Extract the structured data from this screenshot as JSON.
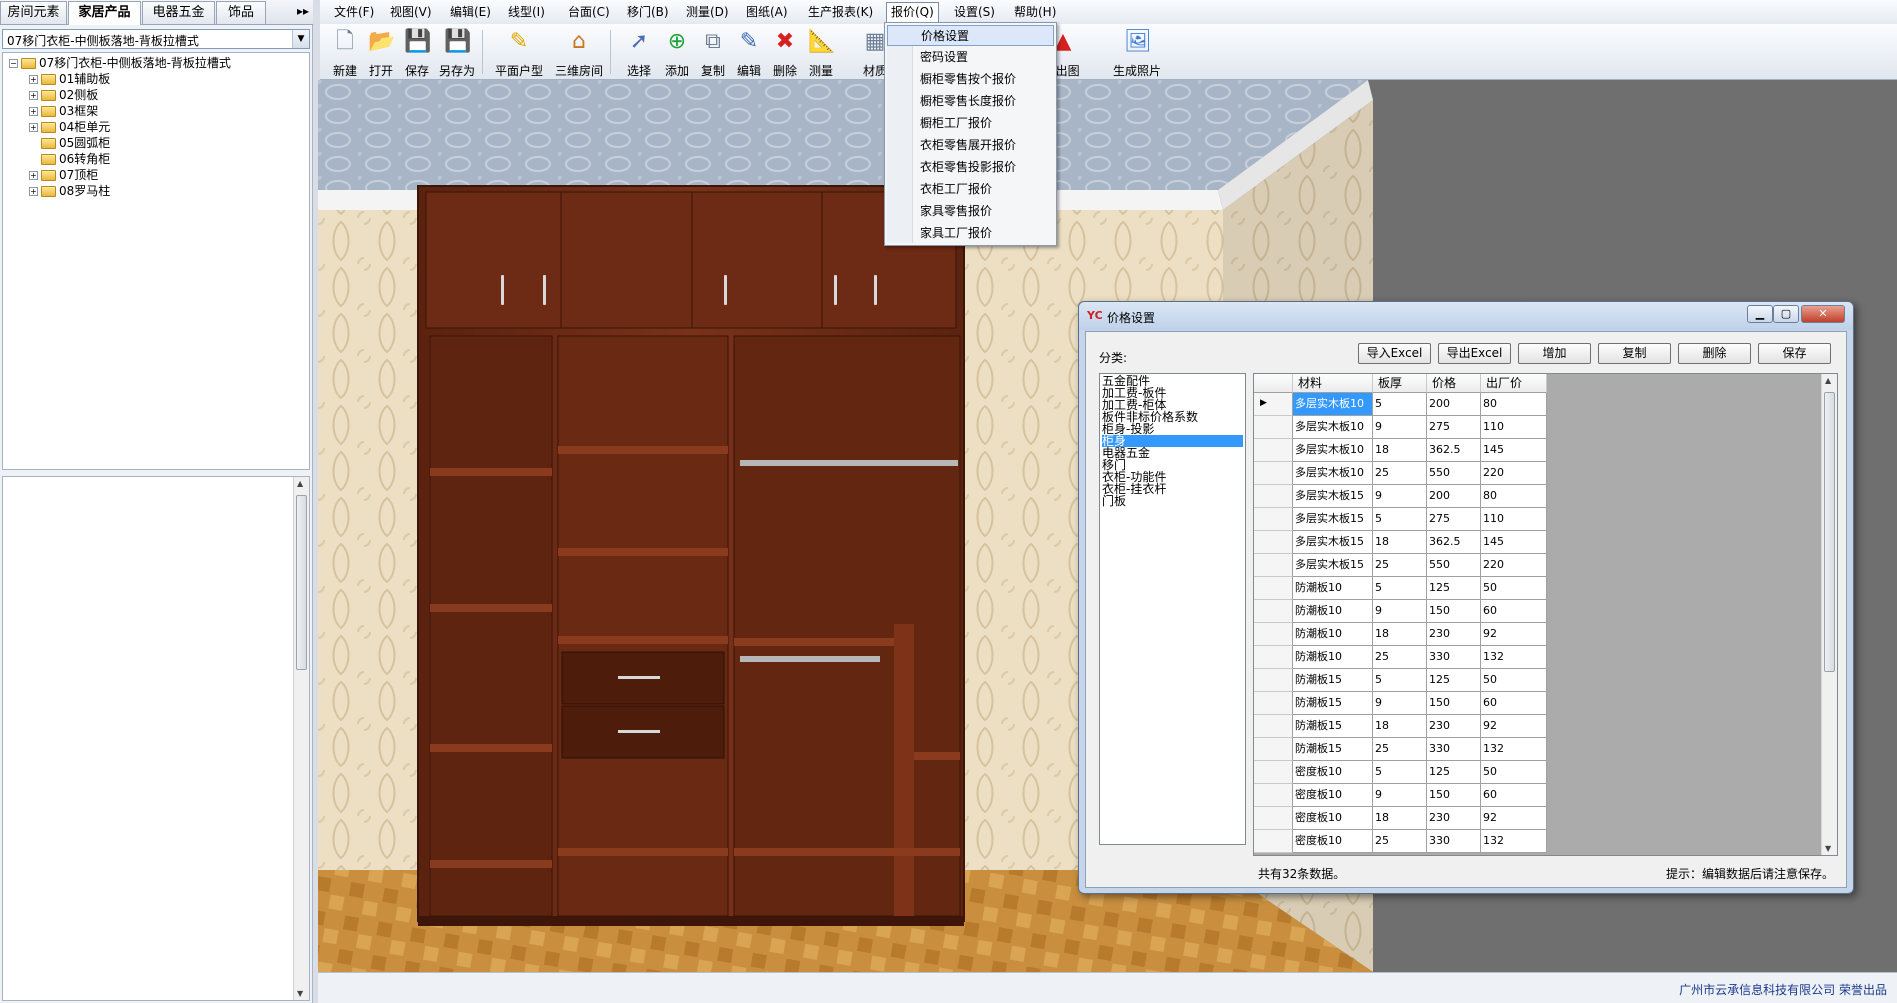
{
  "left": {
    "tabs": [
      "房间元素",
      "家居产品",
      "电器五金",
      "饰品"
    ],
    "tab_more": "▸▸",
    "selector_value": "07移门衣柜-中侧板落地-背板拉槽式",
    "tree_root": "07移门衣柜-中侧板落地-背板拉槽式",
    "tree_items": [
      "01辅助板",
      "02侧板",
      "03框架",
      "04柜单元",
      "05圆弧柜",
      "06转角柜",
      "07顶柜",
      "08罗马柱"
    ]
  },
  "menu": [
    "文件(F)",
    "视图(V)",
    "编辑(E)",
    "线型(I)",
    "台面(C)",
    "移门(B)",
    "测量(D)",
    "图纸(A)",
    "生产报表(K)",
    "报价(Q)",
    "设置(S)",
    "帮助(H)"
  ],
  "toolbar": [
    "新建",
    "打开",
    "保存",
    "另存为",
    "平面户型",
    "三维房间",
    "选择",
    "添加",
    "复制",
    "编辑",
    "删除",
    "测量",
    "材质",
    "D出图",
    "生成照片"
  ],
  "quote_menu": [
    "价格设置",
    "密码设置",
    "橱柜零售按个报价",
    "橱柜零售长度报价",
    "橱柜工厂报价",
    "衣柜零售展开报价",
    "衣柜零售投影报价",
    "衣柜工厂报价",
    "家具零售报价",
    "家具工厂报价"
  ],
  "dialog": {
    "title": "价格设置",
    "logo": "YC",
    "category_label": "分类:",
    "buttons": [
      "导入Excel",
      "导出Excel",
      "增加",
      "复制",
      "删除",
      "保存"
    ],
    "categories": [
      "五金配件",
      "加工费-板件",
      "加工费-柜体",
      "板件非标价格系数",
      "柜身-投影",
      "柜身",
      "电器五金",
      "移门",
      "衣柜-功能件",
      "衣柜-挂衣杆",
      "门板"
    ],
    "selected_category_index": 5,
    "columns": [
      "材料",
      "板厚",
      "价格",
      "出厂价"
    ],
    "rows": [
      [
        "多层实木板10",
        "5",
        "200",
        "80"
      ],
      [
        "多层实木板10",
        "9",
        "275",
        "110"
      ],
      [
        "多层实木板10",
        "18",
        "362.5",
        "145"
      ],
      [
        "多层实木板10",
        "25",
        "550",
        "220"
      ],
      [
        "多层实木板15",
        "9",
        "200",
        "80"
      ],
      [
        "多层实木板15",
        "5",
        "275",
        "110"
      ],
      [
        "多层实木板15",
        "18",
        "362.5",
        "145"
      ],
      [
        "多层实木板15",
        "25",
        "550",
        "220"
      ],
      [
        "防潮板10",
        "5",
        "125",
        "50"
      ],
      [
        "防潮板10",
        "9",
        "150",
        "60"
      ],
      [
        "防潮板10",
        "18",
        "230",
        "92"
      ],
      [
        "防潮板10",
        "25",
        "330",
        "132"
      ],
      [
        "防潮板15",
        "5",
        "125",
        "50"
      ],
      [
        "防潮板15",
        "9",
        "150",
        "60"
      ],
      [
        "防潮板15",
        "18",
        "230",
        "92"
      ],
      [
        "防潮板15",
        "25",
        "330",
        "132"
      ],
      [
        "密度板10",
        "5",
        "125",
        "50"
      ],
      [
        "密度板10",
        "9",
        "150",
        "60"
      ],
      [
        "密度板10",
        "18",
        "230",
        "92"
      ],
      [
        "密度板10",
        "25",
        "330",
        "132"
      ]
    ],
    "footer_count": "共有32条数据。",
    "footer_tip": "提示：编辑数据后请注意保存。"
  },
  "status": {
    "company": "广州市云承信息科技有限公司 荣誉出品"
  },
  "colors": {
    "wood": "#6b2a14",
    "ceiling": "#a9b7c9",
    "wall": "#e9dcc0",
    "floor": "#c58a3c",
    "selection": "#3399ff"
  }
}
